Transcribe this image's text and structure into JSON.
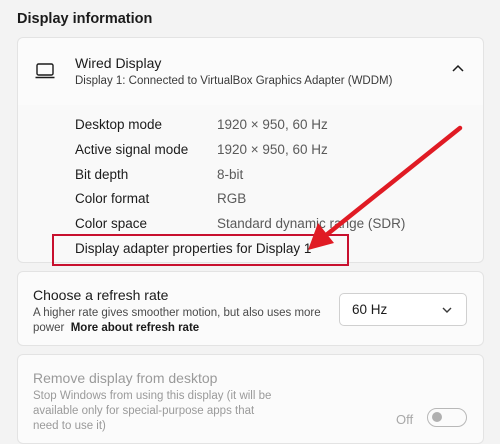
{
  "section_title": "Display information",
  "display": {
    "name": "Wired Display",
    "subtitle": "Display 1: Connected to VirtualBox Graphics Adapter (WDDM)",
    "icon": "monitor-icon",
    "expanded": true
  },
  "details": [
    {
      "label": "Desktop mode",
      "value": "1920 × 950, 60 Hz"
    },
    {
      "label": "Active signal mode",
      "value": "1920 × 950, 60 Hz"
    },
    {
      "label": "Bit depth",
      "value": "8-bit"
    },
    {
      "label": "Color format",
      "value": "RGB"
    },
    {
      "label": "Color space",
      "value": "Standard dynamic range (SDR)"
    }
  ],
  "adapter_link": "Display adapter properties for Display 1",
  "refresh": {
    "title": "Choose a refresh rate",
    "desc": "A higher rate gives smoother motion, but also uses more power",
    "link": "More about refresh rate",
    "selected": "60 Hz"
  },
  "remove": {
    "title": "Remove display from desktop",
    "desc": "Stop Windows from using this display (it will be available only for special-purpose apps that need to use it)",
    "toggle_label": "Off",
    "toggle_on": false
  },
  "colors": {
    "highlight_box": "#c8102e",
    "annotation_arrow": "#e01b24"
  }
}
